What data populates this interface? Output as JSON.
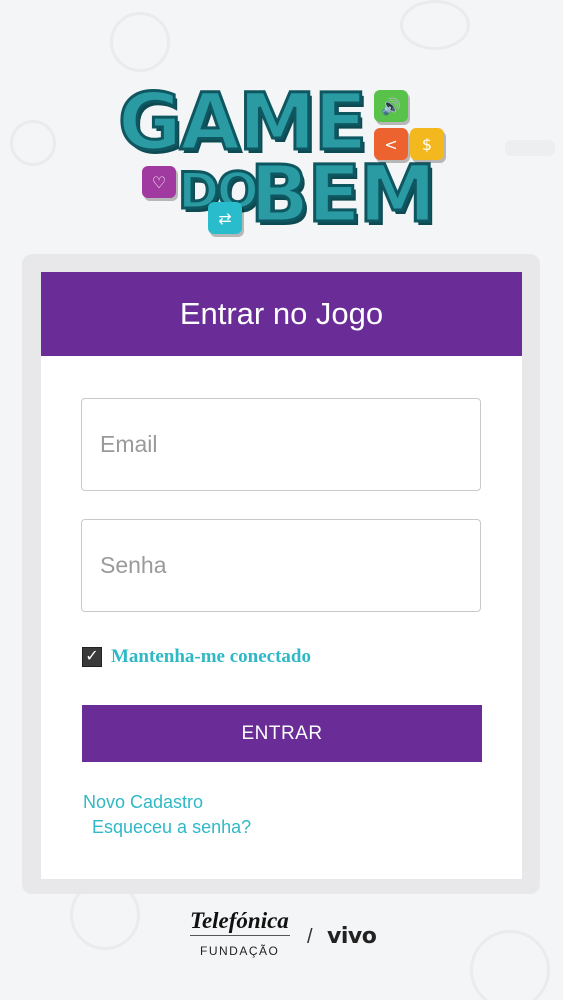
{
  "logo": {
    "line1": "GAME",
    "line2_left": "DO",
    "line2_right": "BEM",
    "tiles": {
      "green": "🔊",
      "orange": "<",
      "yellow": "$",
      "purple": "♡",
      "cyan": "⇄"
    }
  },
  "form": {
    "title": "Entrar no Jogo",
    "email_placeholder": "Email",
    "password_placeholder": "Senha",
    "remember_label": "Mantenha-me conectado",
    "remember_checked": true,
    "submit_label": "ENTRAR",
    "register_link": "Novo Cadastro",
    "forgot_link": "Esqueceu a senha?"
  },
  "footer": {
    "telefonica": "Telefónica",
    "fundacao": "FUNDAÇÃO",
    "separator": "/",
    "vivo": "vivo"
  },
  "colors": {
    "primary": "#6a2d98",
    "link": "#2fb8c6",
    "logo_teal": "#2a9aa3"
  }
}
